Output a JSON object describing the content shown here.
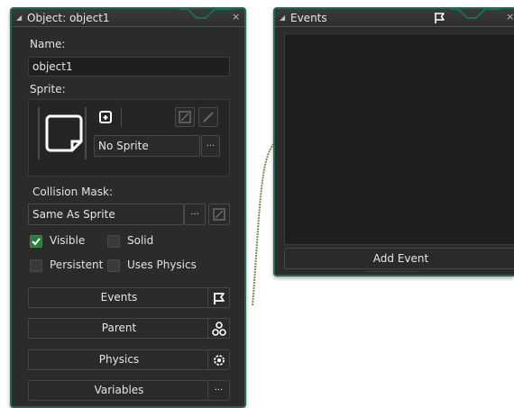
{
  "object_panel": {
    "title": "Object: object1",
    "name_label": "Name:",
    "name_value": "object1",
    "sprite_label": "Sprite:",
    "sprite_value": "No Sprite",
    "collision_label": "Collision Mask:",
    "collision_value": "Same As Sprite",
    "checkboxes": [
      {
        "label": "Visible",
        "checked": true
      },
      {
        "label": "Solid",
        "checked": false
      },
      {
        "label": "Persistent",
        "checked": false
      },
      {
        "label": "Uses Physics",
        "checked": false
      }
    ],
    "buttons": [
      {
        "label": "Events",
        "icon": "flag-icon"
      },
      {
        "label": "Parent",
        "icon": "hierarchy-icon"
      },
      {
        "label": "Physics",
        "icon": "physics-gear-icon"
      },
      {
        "label": "Variables",
        "icon": "ellipsis-icon"
      }
    ],
    "ellipsis": "···",
    "close": "×"
  },
  "events_panel": {
    "title": "Events",
    "add_event_label": "Add Event",
    "close": "×"
  },
  "colors": {
    "accent": "#1f6b4a",
    "panel_bg": "#2b2b2b",
    "check_green": "#2f7a3a"
  }
}
